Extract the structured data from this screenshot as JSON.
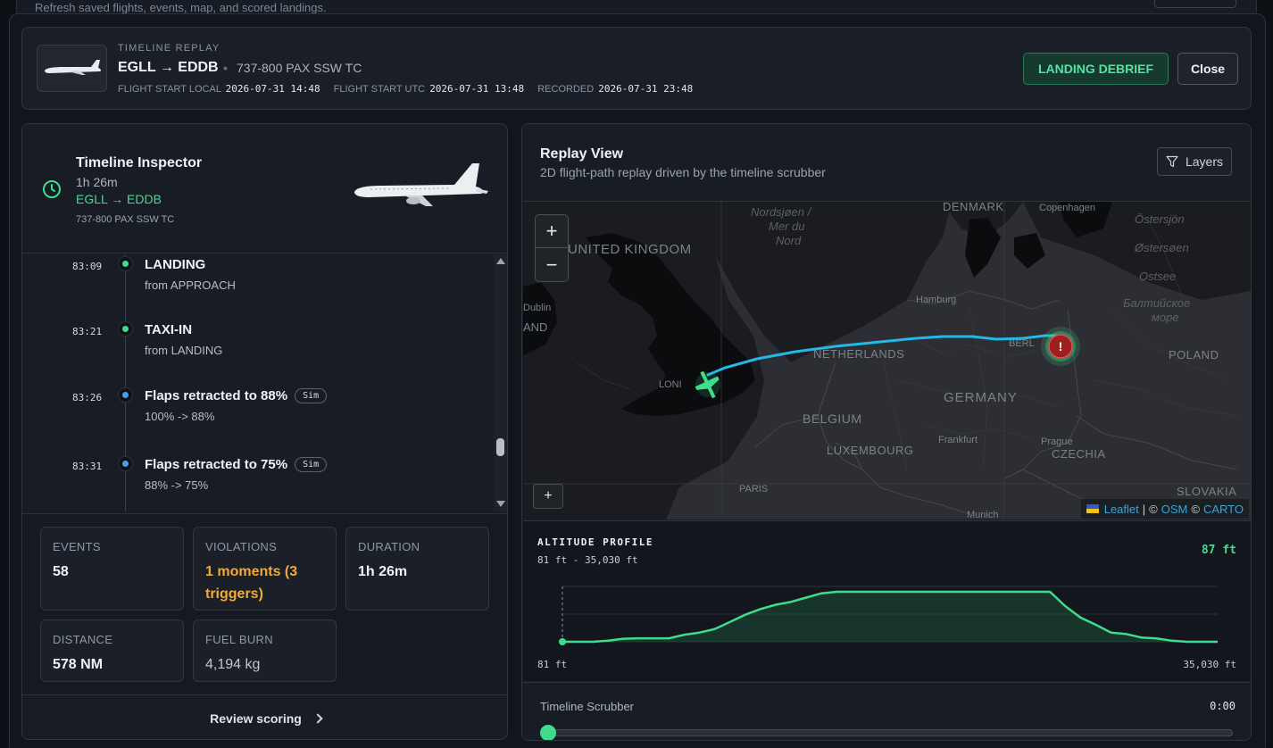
{
  "background": {
    "hint_text": "Refresh saved flights, events, map, and scored landings."
  },
  "header": {
    "eyebrow": "TIMELINE REPLAY",
    "route": "EGLL → EDDB",
    "aircraft": "737-800 PAX SSW TC",
    "meta": [
      {
        "label": "FLIGHT START LOCAL",
        "value": "2026-07-31 14:48"
      },
      {
        "label": "FLIGHT START UTC",
        "value": "2026-07-31 13:48"
      },
      {
        "label": "RECORDED",
        "value": "2026-07-31 23:48"
      }
    ],
    "debrief_label": "LANDING DEBRIEF",
    "close_label": "Close"
  },
  "inspector": {
    "title": "Timeline Inspector",
    "duration": "1h 26m",
    "route": "EGLL → EDDB",
    "aircraft": "737-800 PAX SSW TC"
  },
  "timeline": {
    "events": [
      {
        "time": "83:09",
        "title": "LANDING",
        "subtitle": "from APPROACH",
        "badge": "",
        "dot_color": "#3fdc8b"
      },
      {
        "time": "83:21",
        "title": "TAXI-IN",
        "subtitle": "from LANDING",
        "badge": "",
        "dot_color": "#3fdc8b"
      },
      {
        "time": "83:26",
        "title": "Flaps retracted to 88%",
        "subtitle": "100% -> 88%",
        "badge": "Sim",
        "dot_color": "#4a9cf0"
      },
      {
        "time": "83:31",
        "title": "Flaps retracted to 75%",
        "subtitle": "88% -> 75%",
        "badge": "Sim",
        "dot_color": "#4a9cf0"
      }
    ]
  },
  "stats": {
    "events": {
      "label": "EVENTS",
      "value": "58"
    },
    "violations": {
      "label": "VIOLATIONS",
      "value": "1 moments (3 triggers)"
    },
    "duration": {
      "label": "DURATION",
      "value": "1h 26m"
    },
    "distance": {
      "label": "DISTANCE",
      "value": "578 NM"
    },
    "fuel": {
      "label": "FUEL BURN",
      "value": "4,194 kg"
    }
  },
  "review_label": "Review scoring",
  "replay": {
    "title": "Replay View",
    "subtitle": "2D flight-path replay driven by the timeline scrubber",
    "layers_label": "Layers"
  },
  "map": {
    "labels": {
      "uk": "UNITED KINGDOM",
      "north_sea": "Nordsjøen /",
      "north_sea2": "Mer du",
      "north_sea3": "Nord",
      "denmark": "DENMARK",
      "copenhagen": "Copenhagen",
      "ostersjon": "Östersjön",
      "ostersoen": "Østersøen",
      "ostsee": "Ostsee",
      "baltic": "Балтийское",
      "baltic2": "море",
      "dublin": "Dublin",
      "and": "AND",
      "hamburg": "Hamburg",
      "berlin": "BERL",
      "poland": "POLAND",
      "netherlands": "NETHERLANDS",
      "london": "LONI",
      "germany": "GERMANY",
      "belgium": "BELGIUM",
      "frankfurt": "Frankfurt",
      "prague": "Prague",
      "luxembourg": "LUXEMBOURG",
      "czechia": "CZECHIA",
      "paris": "PARIS",
      "slovakia": "SLOVAKIA",
      "munich": "Munich"
    },
    "alert_glyph": "!",
    "attrib_leaflet": "Leaflet",
    "attrib_sep": "|",
    "attrib_copy1": "©",
    "attrib_osm": "OSM",
    "attrib_copy2": "©",
    "attrib_carto": "CARTO",
    "zoom_in": "+",
    "zoom_out": "−",
    "small_plus": "+"
  },
  "altitude": {
    "title": "ALTITUDE PROFILE",
    "range": "81 ft - 35,030 ft",
    "current": "87 ft",
    "low_label": "81 ft",
    "high_label": "35,030 ft",
    "min_ft": 81,
    "max_ft": 35030,
    "profile": [
      81,
      81,
      81,
      800,
      2200,
      2500,
      2500,
      2500,
      5000,
      6500,
      9000,
      14000,
      19000,
      23000,
      26000,
      28000,
      31000,
      34000,
      35030,
      35030,
      35030,
      35030,
      35030,
      35030,
      35030,
      35030,
      35030,
      35030,
      35030,
      35030,
      35030,
      35030,
      35030,
      25000,
      17000,
      12000,
      6500,
      5500,
      3000,
      2400,
      800,
      81,
      81,
      81
    ]
  },
  "scrubber": {
    "label": "Timeline Scrubber",
    "time": "0:00",
    "position": 0
  }
}
